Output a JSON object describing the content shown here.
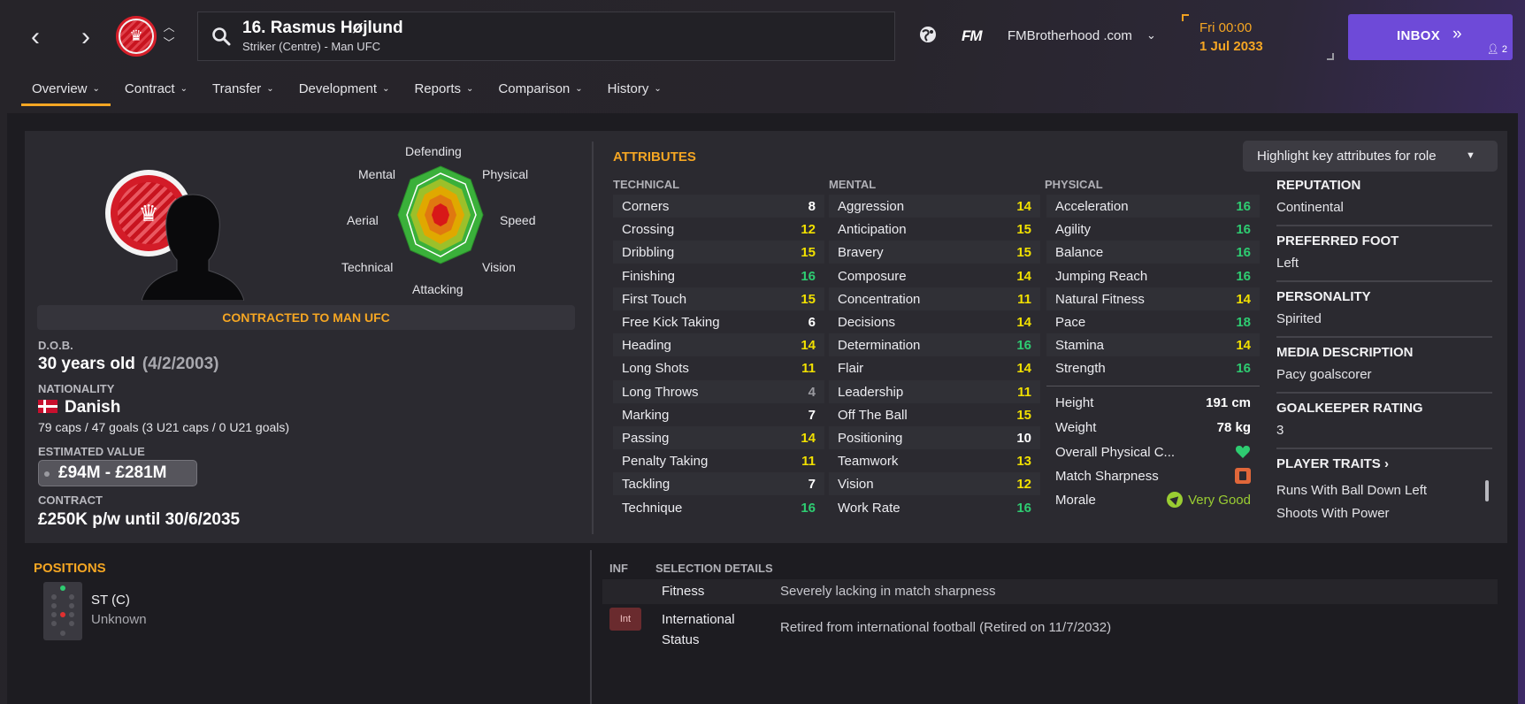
{
  "header": {
    "player_name": "16. Rasmus Højlund",
    "player_sub": "Striker (Centre) - Man UFC",
    "brand": "FM",
    "site": "FMBrotherhood .com",
    "date_day": "Fri 00:00",
    "date": "1 Jul 2033",
    "inbox_label": "INBOX",
    "inbox_count": "2",
    "accent_color": "#f5a623",
    "inbox_color": "#6e4ad8"
  },
  "tabs": [
    "Overview",
    "Contract",
    "Transfer",
    "Development",
    "Reports",
    "Comparison",
    "History"
  ],
  "radar": {
    "labels": {
      "defending": "Defending",
      "physical": "Physical",
      "speed": "Speed",
      "vision": "Vision",
      "attacking": "Attacking",
      "technical": "Technical",
      "aerial": "Aerial",
      "mental": "Mental"
    }
  },
  "card": {
    "contracted": "CONTRACTED TO MAN UFC",
    "dob_label": "D.O.B.",
    "age": "30 years old",
    "dob": "(4/2/2003)",
    "nationality_label": "NATIONALITY",
    "nationality": "Danish",
    "caps": "79 caps / 47 goals (3 U21 caps / 0 U21 goals)",
    "value_label": "ESTIMATED VALUE",
    "value": "£94M - £281M",
    "contract_label": "CONTRACT",
    "contract": "£250K p/w until 30/6/2035"
  },
  "attributes": {
    "title": "ATTRIBUTES",
    "highlight_label": "Highlight key attributes for role",
    "technical_header": "TECHNICAL",
    "mental_header": "MENTAL",
    "physical_header": "PHYSICAL",
    "technical": [
      {
        "name": "Corners",
        "value": "8"
      },
      {
        "name": "Crossing",
        "value": "12"
      },
      {
        "name": "Dribbling",
        "value": "15"
      },
      {
        "name": "Finishing",
        "value": "16"
      },
      {
        "name": "First Touch",
        "value": "15"
      },
      {
        "name": "Free Kick Taking",
        "value": "6"
      },
      {
        "name": "Heading",
        "value": "14"
      },
      {
        "name": "Long Shots",
        "value": "11"
      },
      {
        "name": "Long Throws",
        "value": "4"
      },
      {
        "name": "Marking",
        "value": "7"
      },
      {
        "name": "Passing",
        "value": "14"
      },
      {
        "name": "Penalty Taking",
        "value": "11"
      },
      {
        "name": "Tackling",
        "value": "7"
      },
      {
        "name": "Technique",
        "value": "16"
      }
    ],
    "mental": [
      {
        "name": "Aggression",
        "value": "14"
      },
      {
        "name": "Anticipation",
        "value": "15"
      },
      {
        "name": "Bravery",
        "value": "15"
      },
      {
        "name": "Composure",
        "value": "14"
      },
      {
        "name": "Concentration",
        "value": "11"
      },
      {
        "name": "Decisions",
        "value": "14"
      },
      {
        "name": "Determination",
        "value": "16"
      },
      {
        "name": "Flair",
        "value": "14"
      },
      {
        "name": "Leadership",
        "value": "11"
      },
      {
        "name": "Off The Ball",
        "value": "15"
      },
      {
        "name": "Positioning",
        "value": "10"
      },
      {
        "name": "Teamwork",
        "value": "13"
      },
      {
        "name": "Vision",
        "value": "12"
      },
      {
        "name": "Work Rate",
        "value": "16"
      }
    ],
    "physical": [
      {
        "name": "Acceleration",
        "value": "16"
      },
      {
        "name": "Agility",
        "value": "16"
      },
      {
        "name": "Balance",
        "value": "16"
      },
      {
        "name": "Jumping Reach",
        "value": "16"
      },
      {
        "name": "Natural Fitness",
        "value": "14"
      },
      {
        "name": "Pace",
        "value": "18"
      },
      {
        "name": "Stamina",
        "value": "14"
      },
      {
        "name": "Strength",
        "value": "16"
      }
    ],
    "height_label": "Height",
    "height": "191 cm",
    "weight_label": "Weight",
    "weight": "78 kg",
    "overall_condition_label": "Overall Physical C...",
    "match_sharpness_label": "Match Sharpness",
    "morale_label": "Morale",
    "morale": "Very Good"
  },
  "info": {
    "reputation_label": "REPUTATION",
    "reputation": "Continental",
    "foot_label": "PREFERRED FOOT",
    "foot": "Left",
    "personality_label": "PERSONALITY",
    "personality": "Spirited",
    "media_label": "MEDIA DESCRIPTION",
    "media": "Pacy goalscorer",
    "gk_label": "GOALKEEPER RATING",
    "gk": "3",
    "traits_label": "PLAYER TRAITS",
    "traits": [
      "Runs With Ball Down Left",
      "Shoots With Power"
    ]
  },
  "positions": {
    "title": "POSITIONS",
    "position": "ST (C)",
    "rating": "Unknown"
  },
  "selection": {
    "inf_header": "INF",
    "details_header": "SELECTION DETAILS",
    "rows": [
      {
        "badge": "",
        "name": "Fitness",
        "value": "Severely lacking in match sharpness"
      },
      {
        "badge": "Int",
        "name": "International Status",
        "value": "Retired from international football (Retired on 11/7/2032)"
      }
    ]
  }
}
